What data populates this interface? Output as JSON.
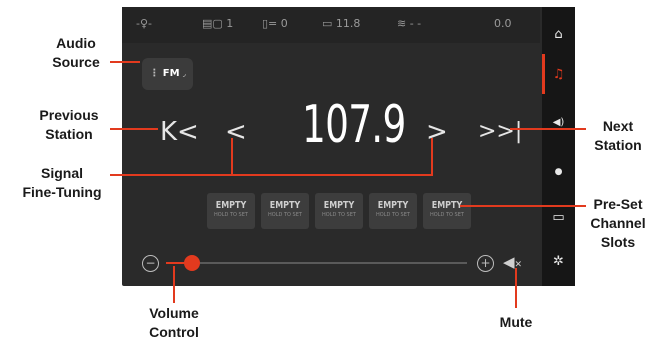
{
  "colors": {
    "accent": "#e23a1e",
    "screen_bg": "#2a2a2a",
    "sidebar_bg": "#161616"
  },
  "status_bar": {
    "items": [
      {
        "icon": "fan-icon",
        "text": "-♀-"
      },
      {
        "icon": "seat-heat-icon",
        "text": "1"
      },
      {
        "icon": "seat-heat-icon",
        "text": "0"
      },
      {
        "icon": "battery-icon",
        "text": "11.8"
      },
      {
        "icon": "wifi-icon",
        "text": "- -"
      },
      {
        "icon": "speed-icon",
        "text": "0.0"
      }
    ]
  },
  "sidebar": {
    "items": [
      {
        "icon": "home-icon",
        "glyph": "⌂",
        "active": false
      },
      {
        "icon": "music-note-icon",
        "glyph": "♫",
        "active": true
      },
      {
        "icon": "speaker-icon",
        "glyph": "◀)",
        "active": false
      },
      {
        "icon": "location-pin-icon",
        "glyph": "●",
        "active": false
      },
      {
        "icon": "camera-icon",
        "glyph": "▭",
        "active": false
      },
      {
        "icon": "gear-icon",
        "glyph": "✲",
        "active": false
      }
    ]
  },
  "radio": {
    "source_label": "FM",
    "frequency": "107.9",
    "prev_station_glyph": "K<",
    "next_station_glyph": ">>|",
    "tune_down_glyph": "<",
    "tune_up_glyph": ">",
    "presets": [
      {
        "label": "EMPTY",
        "sub": "HOLD TO SET"
      },
      {
        "label": "EMPTY",
        "sub": "HOLD TO SET"
      },
      {
        "label": "EMPTY",
        "sub": "HOLD TO SET"
      },
      {
        "label": "EMPTY",
        "sub": "HOLD TO SET"
      },
      {
        "label": "EMPTY",
        "sub": "HOLD TO SET"
      }
    ],
    "volume_level": 0.06,
    "volume_minus": "−",
    "volume_plus": "+",
    "mute_glyph": "✕"
  },
  "callouts": {
    "audio_source": [
      "Audio",
      "Source"
    ],
    "previous_station": [
      "Previous",
      "Station"
    ],
    "signal_fine_tuning": [
      "Signal",
      "Fine-Tuning"
    ],
    "volume_control": [
      "Volume",
      "Control"
    ],
    "next_station": [
      "Next",
      "Station"
    ],
    "preset_slots": [
      "Pre-Set",
      "Channel",
      "Slots"
    ],
    "mute": [
      "Mute"
    ]
  }
}
